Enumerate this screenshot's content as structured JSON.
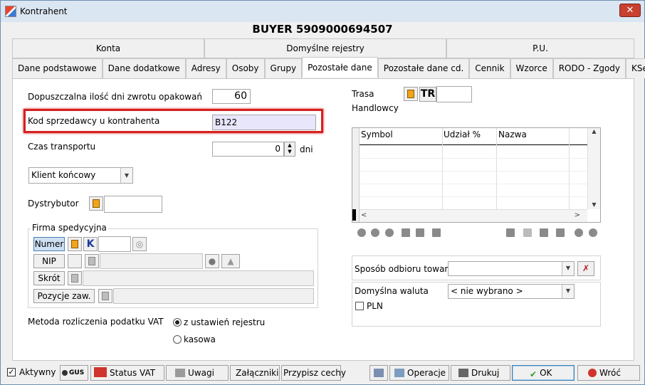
{
  "window": {
    "title": "Kontrahent",
    "close": "✕"
  },
  "heading": "BUYER 5909000694507",
  "tabs_row1": [
    "Konta",
    "Domyślne rejestry",
    "P.U."
  ],
  "tabs_row2": [
    "Dane podstawowe",
    "Dane dodatkowe",
    "Adresy",
    "Osoby",
    "Grupy",
    "Pozostałe dane",
    "Pozostałe dane cd.",
    "Cennik",
    "Wzorce",
    "RODO - Zgody",
    "KSeF"
  ],
  "active_tab": "Pozostałe dane",
  "left": {
    "return_days_label": "Dopuszczalna ilość dni zwrotu opakowań",
    "return_days_value": "60",
    "seller_code_label": "Kod sprzedawcy u kontrahenta",
    "seller_code_value": "B122",
    "transport_label": "Czas transportu",
    "transport_value": "0",
    "transport_unit": "dni",
    "client_type": "Klient końcowy",
    "distributor_label": "Dystrybutor",
    "shipping_group_label": "Firma spedycyjna",
    "shipping_numer": "Numer",
    "shipping_nip": "NIP",
    "shipping_short": "Skrót",
    "shipping_positions": "Pozycje zaw.",
    "shipping_k": "K",
    "vat_label": "Metoda rozliczenia podatku VAT",
    "vat_option1": "z ustawień rejestru",
    "vat_option2": "kasowa"
  },
  "right": {
    "route_label": "Trasa",
    "route_label2": "Handlowcy",
    "route_code": "TR",
    "grid_cols": [
      "Symbol",
      "Udział %",
      "Nazwa"
    ],
    "pickup_label": "Sposób odbioru towaru",
    "currency_label": "Domyślna waluta",
    "currency_value": "< nie wybrano >",
    "pln_label": "PLN"
  },
  "bottom": {
    "active_label": "Aktywny",
    "gus": "GUS",
    "status_vat": "Status VAT",
    "notes": "Uwagi",
    "attachments": "Załączniki",
    "assign_features": "Przypisz cechy",
    "operations": "Operacje",
    "print": "Drukuj",
    "ok": "OK",
    "back": "Wróć"
  },
  "colors": {
    "highlight": "#d62121",
    "selected_input": "#e8e6fa"
  }
}
